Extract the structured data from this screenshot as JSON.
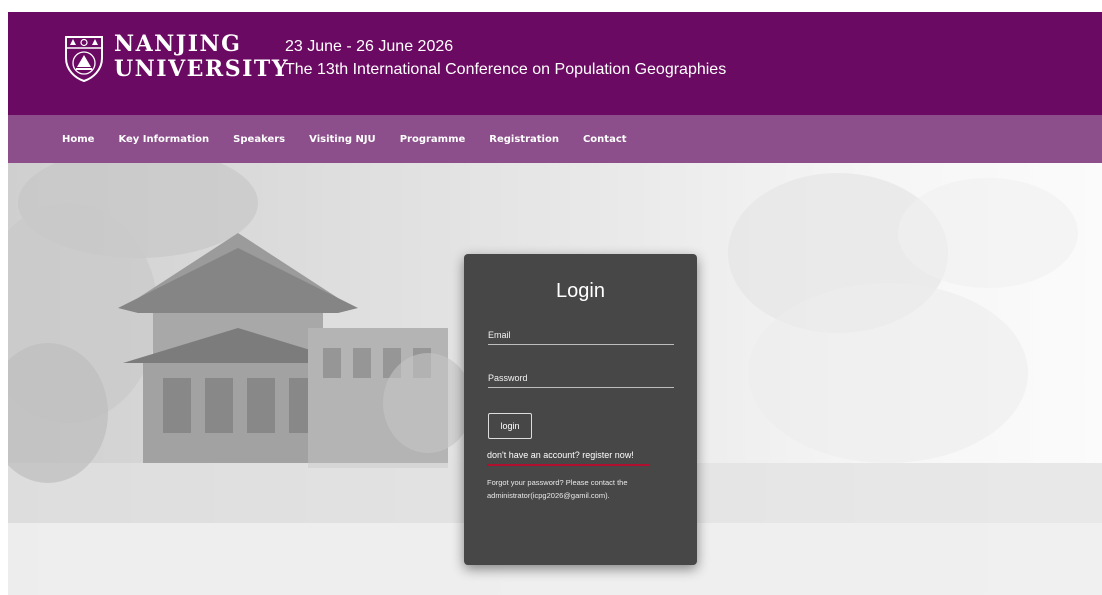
{
  "header": {
    "brand_line1": "NANJING",
    "brand_line2": "UNIVERSITY",
    "conference_dates": "23 June - 26 June 2026",
    "conference_name": "The 13th International Conference on Population Geographies"
  },
  "nav": {
    "items": [
      "Home",
      "Key Information",
      "Speakers",
      "Visiting NJU",
      "Programme",
      "Registration",
      "Contact"
    ]
  },
  "login": {
    "title": "Login",
    "email_placeholder": "Email",
    "password_placeholder": "Password",
    "button_label": "login",
    "register_text": "don't have an account? register now!",
    "forgot_text": "Forgot your password? Please contact the administrator(icpg2026@gamil.com)."
  },
  "colors": {
    "header_bg": "#6b0a62",
    "nav_bg": "#8c4f8b",
    "card_bg": "#474747",
    "accent_underline": "#b0102e"
  },
  "icons": {
    "logo": "university-crest-icon"
  }
}
